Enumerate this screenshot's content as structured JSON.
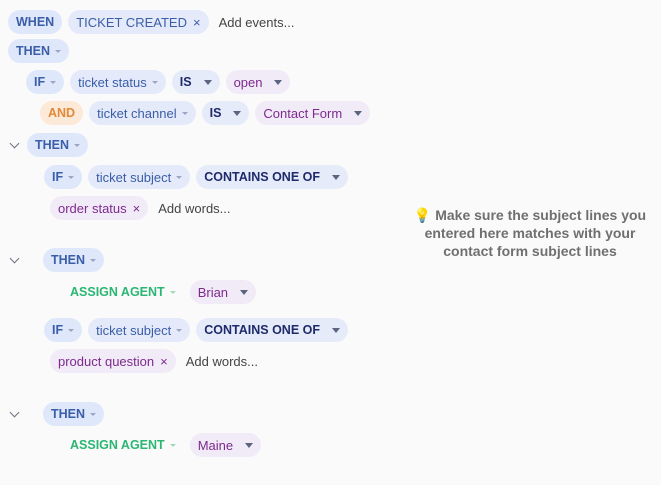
{
  "rule": {
    "when_label": "WHEN",
    "trigger": "TICKET CREATED",
    "add_events": "Add events...",
    "then_label": "THEN",
    "if_label": "IF",
    "and_label": "AND",
    "is_label": "IS",
    "contains_label": "CONTAINS ONE OF",
    "assign_label": "ASSIGN AGENT",
    "add_words": "Add words...",
    "field_status": "ticket status",
    "value_status": "open",
    "field_channel": "ticket channel",
    "value_channel": "Contact Form",
    "field_subject": "ticket subject",
    "word_1": "order status",
    "agent_1": "Brian",
    "word_2": "product question",
    "agent_2": "Maine"
  },
  "tip": {
    "icon": "lightbulb-icon",
    "text": "Make sure the subject lines you entered here matches with your contact form subject lines"
  },
  "icons": {
    "remove": "×"
  }
}
